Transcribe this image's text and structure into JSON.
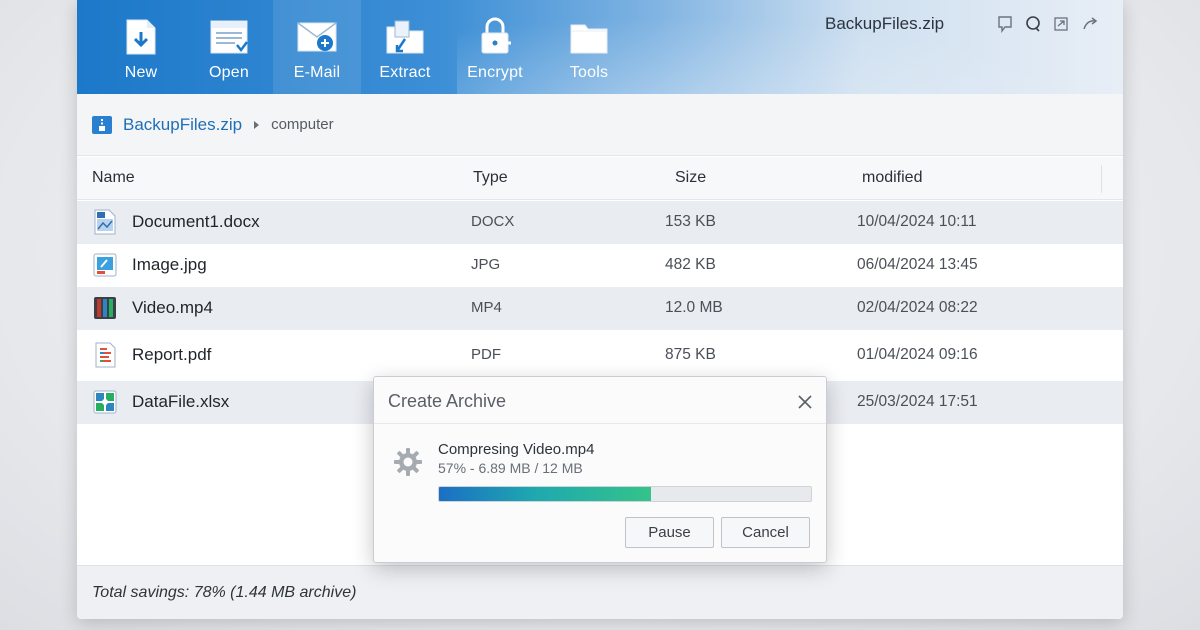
{
  "window": {
    "title": "BackupFiles.zip"
  },
  "ribbon": {
    "buttons": [
      {
        "label": "New",
        "icon": "new-archive-icon"
      },
      {
        "label": "Open",
        "icon": "open-icon"
      },
      {
        "label": "E-Mail",
        "icon": "email-icon"
      },
      {
        "label": "Extract",
        "icon": "extract-icon"
      },
      {
        "label": "Encrypt",
        "icon": "encrypt-icon"
      },
      {
        "label": "Tools",
        "icon": "tools-icon"
      }
    ],
    "active_button": "E-Mail"
  },
  "breadcrumb": {
    "archive": "BackupFiles.zip",
    "folder": "computer"
  },
  "table": {
    "columns": [
      "Name",
      "Type",
      "Size",
      "modified"
    ],
    "rows": [
      {
        "name": "Document1.docx",
        "type": "DOCX",
        "size": "153 KB",
        "modified": "10/04/2024 10:11",
        "icon": "word-document-icon"
      },
      {
        "name": "Image.jpg",
        "type": "JPG",
        "size": "482 KB",
        "modified": "06/04/2024 13:45",
        "icon": "image-file-icon"
      },
      {
        "name": "Video.mp4",
        "type": "MP4",
        "size": "12.0 MB",
        "modified": "02/04/2024 08:22",
        "icon": "video-file-icon"
      },
      {
        "name": "Report.pdf",
        "type": "PDF",
        "size": "875 KB",
        "modified": "01/04/2024 09:16",
        "icon": "pdf-file-icon"
      },
      {
        "name": "DataFile.xlsx",
        "type": "",
        "size": "",
        "modified": "25/03/2024 17:51",
        "icon": "spreadsheet-file-icon"
      }
    ]
  },
  "status": {
    "text": "Total savings: 78% (1.44 MB archive)"
  },
  "dialog": {
    "title": "Create Archive",
    "message": "Compresing Video.mp4",
    "progress_text": "57% - 6.89 MB / 12 MB",
    "progress_fraction": 0.57,
    "pause_label": "Pause",
    "cancel_label": "Cancel"
  },
  "colors": {
    "ribbon_start": "#1c78c9",
    "accent_link": "#1f6fb8",
    "progress_start": "#1b6fc4",
    "progress_end": "#34c38a"
  }
}
